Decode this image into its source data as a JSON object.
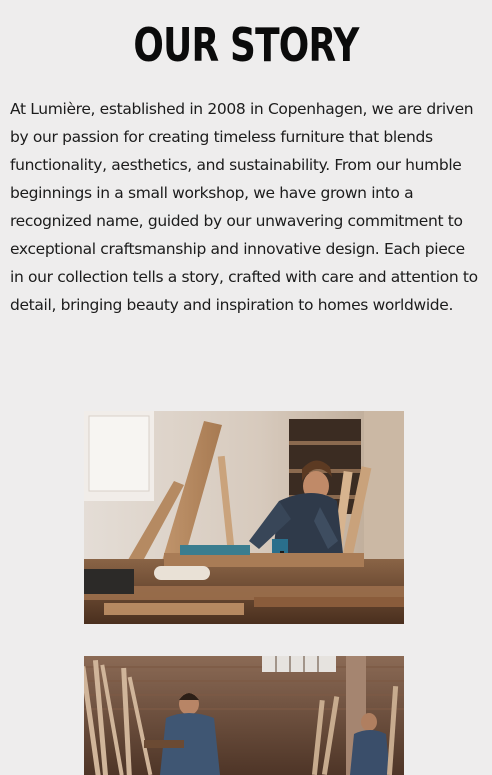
{
  "story": {
    "title": "OUR STORY",
    "body": "At Lumière, established in 2008 in Copenhagen, we are driven by our passion for creating timeless furniture that blends functionality, aesthetics, and sustainability. From our humble beginnings in a small workshop, we have grown into a recognized name, guided by our unwavering commitment to exceptional craftsmanship and innovative design. Each piece in our collection tells a story, crafted with care and attention to detail, bringing beauty and inspiration to homes worldwide."
  },
  "images": [
    {
      "name": "carpenter-workshop-photo",
      "subject": "woodworker-drilling-at-workbench"
    },
    {
      "name": "workshop-team-photo",
      "subject": "two-woodworkers-in-brick-workshop"
    }
  ],
  "colors": {
    "background": "#eeeded",
    "title": "#0b0b0b",
    "text": "#1c1c1c",
    "wood": "#b98b62"
  }
}
